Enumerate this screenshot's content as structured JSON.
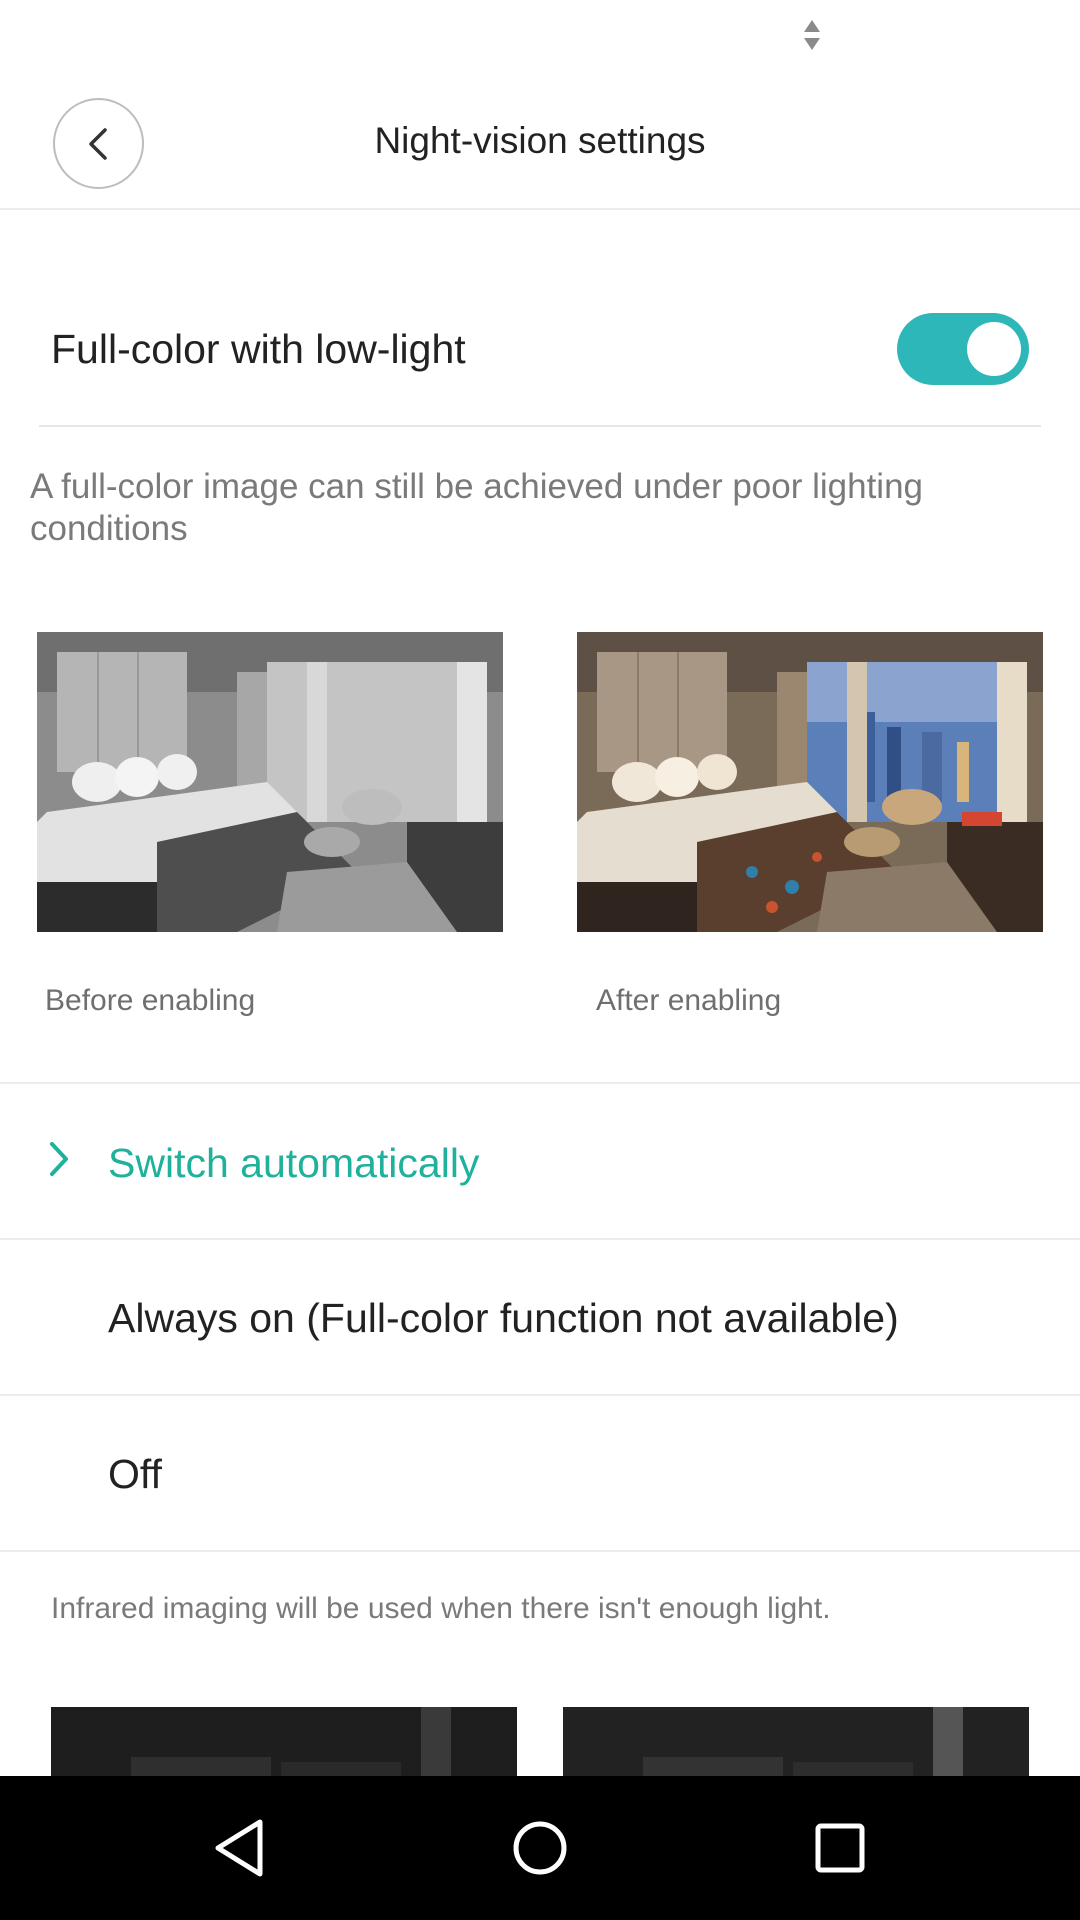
{
  "header": {
    "title": "Night-vision settings",
    "back_icon": "chevron-left-icon"
  },
  "status_bar": {
    "icon": "signal-arrows-icon"
  },
  "full_color": {
    "label": "Full-color with low-light",
    "enabled": true,
    "toggle_color": "#2eb7b8",
    "description": "A full-color image can still be achieved under poor lighting conditions",
    "before_caption": "Before enabling",
    "after_caption": "After enabling"
  },
  "night_vision_options": [
    {
      "label": "Switch automatically",
      "selected": true
    },
    {
      "label": "Always on (Full-color function not available)",
      "selected": false
    },
    {
      "label": "Off",
      "selected": false
    }
  ],
  "accent_color": "#1fb19b",
  "footnote": "Infrared imaging will be used when there isn't enough light.",
  "nav_bar": {
    "back_icon": "triangle-back-icon",
    "home_icon": "circle-home-icon",
    "recents_icon": "square-recents-icon"
  }
}
